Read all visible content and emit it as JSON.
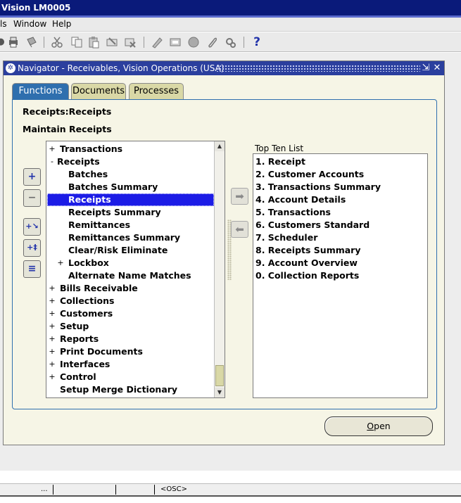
{
  "window": {
    "title": "Vision LM0005"
  },
  "menu": {
    "items": [
      "ls",
      "Window",
      "Help"
    ]
  },
  "toolbar": {
    "icons": [
      "open-icon",
      "print-icon",
      "save-icon",
      "cut-icon",
      "copy-icon",
      "paste-icon",
      "clear-record-icon",
      "delete-record-icon",
      "edit-field-icon",
      "zoom-icon",
      "translation-icon",
      "attachments-icon",
      "folder-tools-icon",
      "help-icon"
    ],
    "help_glyph": "?"
  },
  "navigator": {
    "title": "Navigator - Receivables, Vision Operations (USA)",
    "tabs": [
      "Functions",
      "Documents",
      "Processes"
    ],
    "active_tab": "Functions",
    "breadcrumb": "Receipts:Receipts",
    "description": "Maintain Receipts",
    "tree": [
      {
        "expander": "+",
        "label": "Transactions",
        "level": 0
      },
      {
        "expander": "-",
        "label": "Receipts",
        "level": 0
      },
      {
        "expander": "",
        "label": "Batches",
        "level": 1
      },
      {
        "expander": "",
        "label": "Batches Summary",
        "level": 1
      },
      {
        "expander": "",
        "label": "Receipts",
        "level": 1,
        "selected": true
      },
      {
        "expander": "",
        "label": "Receipts Summary",
        "level": 1
      },
      {
        "expander": "",
        "label": "Remittances",
        "level": 1
      },
      {
        "expander": "",
        "label": "Remittances Summary",
        "level": 1
      },
      {
        "expander": "",
        "label": "Clear/Risk Eliminate",
        "level": 1
      },
      {
        "expander": "+",
        "label": "Lockbox",
        "level": 1
      },
      {
        "expander": "",
        "label": "Alternate Name Matches",
        "level": 1
      },
      {
        "expander": "+",
        "label": "Bills Receivable",
        "level": 0
      },
      {
        "expander": "+",
        "label": "Collections",
        "level": 0
      },
      {
        "expander": "+",
        "label": "Customers",
        "level": 0
      },
      {
        "expander": "+",
        "label": "Setup",
        "level": 0
      },
      {
        "expander": "+",
        "label": "Reports",
        "level": 0
      },
      {
        "expander": "+",
        "label": "Print Documents",
        "level": 0
      },
      {
        "expander": "+",
        "label": "Interfaces",
        "level": 0
      },
      {
        "expander": "+",
        "label": "Control",
        "level": 0
      },
      {
        "expander": "",
        "label": "Setup Merge Dictionary",
        "level": 0
      }
    ],
    "side_buttons": [
      {
        "name": "expand-button",
        "glyph": "+"
      },
      {
        "name": "collapse-button",
        "glyph": "−"
      },
      {
        "name": "expand-branch-button",
        "glyph": "+↘"
      },
      {
        "name": "expand-all-button",
        "glyph": "+‡"
      },
      {
        "name": "collapse-all-button",
        "glyph": "≡"
      }
    ],
    "add_to_list_glyph": "➡",
    "remove_from_list_glyph": "⬅",
    "top_ten_label": "Top Ten List",
    "top_ten": [
      "1. Receipt",
      "2. Customer Accounts",
      "3. Transactions Summary",
      "4. Account Details",
      "5. Transactions",
      "6. Customers Standard",
      "7. Scheduler",
      "8. Receipts Summary",
      "9. Account Overview",
      "0. Collection Reports"
    ],
    "open_button": {
      "mnemonic": "O",
      "rest": "pen"
    }
  },
  "statusbar": {
    "field1": "...",
    "field4": "<OSC>"
  }
}
